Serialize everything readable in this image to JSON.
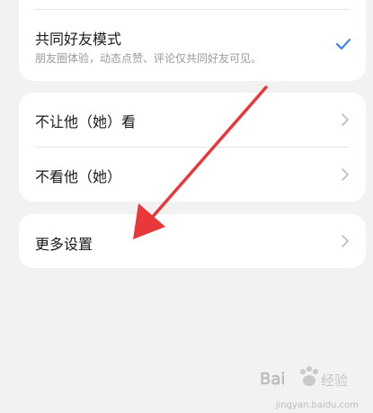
{
  "friend_mode": {
    "title": "共同好友模式",
    "subtitle": "朋友圈体验，动态点赞、评论仅共同好友可见。",
    "checked": true
  },
  "privacy": {
    "items": [
      {
        "label": "不让他（她）看"
      },
      {
        "label": "不看他（她）"
      }
    ]
  },
  "more_settings": {
    "label": "更多设置"
  },
  "colors": {
    "accent": "#2f7bf0",
    "arrow": "#e8383a",
    "background": "#f2f2f2"
  },
  "watermark": {
    "url": "jingyan.baidu.com"
  }
}
